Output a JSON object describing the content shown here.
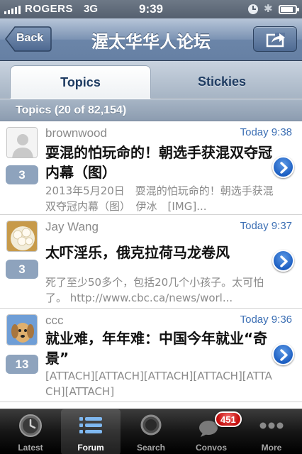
{
  "status_bar": {
    "carrier": "ROGERS",
    "network": "3G",
    "time": "9:39",
    "battery_level": 0.85,
    "icons": [
      "signal-icon",
      "clock-icon",
      "bluetooth-icon",
      "battery-icon"
    ]
  },
  "nav": {
    "back_label": "Back",
    "title": "渥太华华人论坛",
    "share_icon": "share-icon"
  },
  "segments": {
    "active": "Topics",
    "inactive": "Stickies"
  },
  "section_header": "Topics (20 of 82,154)",
  "topics": [
    {
      "author": "brownwood",
      "time": "Today 9:38",
      "title": "耍混的怕玩命的！朝选手获混双夺冠内幕（图）",
      "preview": "2013年5月20日　耍混的怕玩命的！朝选手获混双夺冠内幕（图）　伊冰　[IMG]...",
      "replies": "3",
      "avatar": "default-avatar-icon"
    },
    {
      "author": "Jay Wang",
      "time": "Today 9:37",
      "title": "太吓淫乐，俄克拉荷马龙卷风",
      "preview": "死了至少50多个，包括20几个小孩子。太可怕了。 http://www.cbc.ca/news/worl...",
      "replies": "3",
      "avatar": "food-avatar-icon"
    },
    {
      "author": "ccc",
      "time": "Today 9:36",
      "title": "就业难，年年难：中国今年就业“奇景”",
      "preview": "[ATTACH][ATTACH][ATTACH][ATTACH][ATTACH][ATTACH]",
      "replies": "13",
      "avatar": "puppy-avatar-icon"
    }
  ],
  "tab_bar": {
    "items": [
      {
        "label": "Latest",
        "icon": "clock-icon"
      },
      {
        "label": "Forum",
        "icon": "list-icon"
      },
      {
        "label": "Search",
        "icon": "magnifier-icon"
      },
      {
        "label": "Convos",
        "icon": "speech-bubble-icon"
      },
      {
        "label": "More",
        "icon": "more-dots-icon"
      }
    ],
    "selected": "Forum",
    "convos_badge": "451"
  },
  "colors": {
    "nav_blue": "#6b85a8",
    "link_blue": "#3c6fb4",
    "badge_red": "#c4100f",
    "count_bg": "#8ea3bd"
  }
}
